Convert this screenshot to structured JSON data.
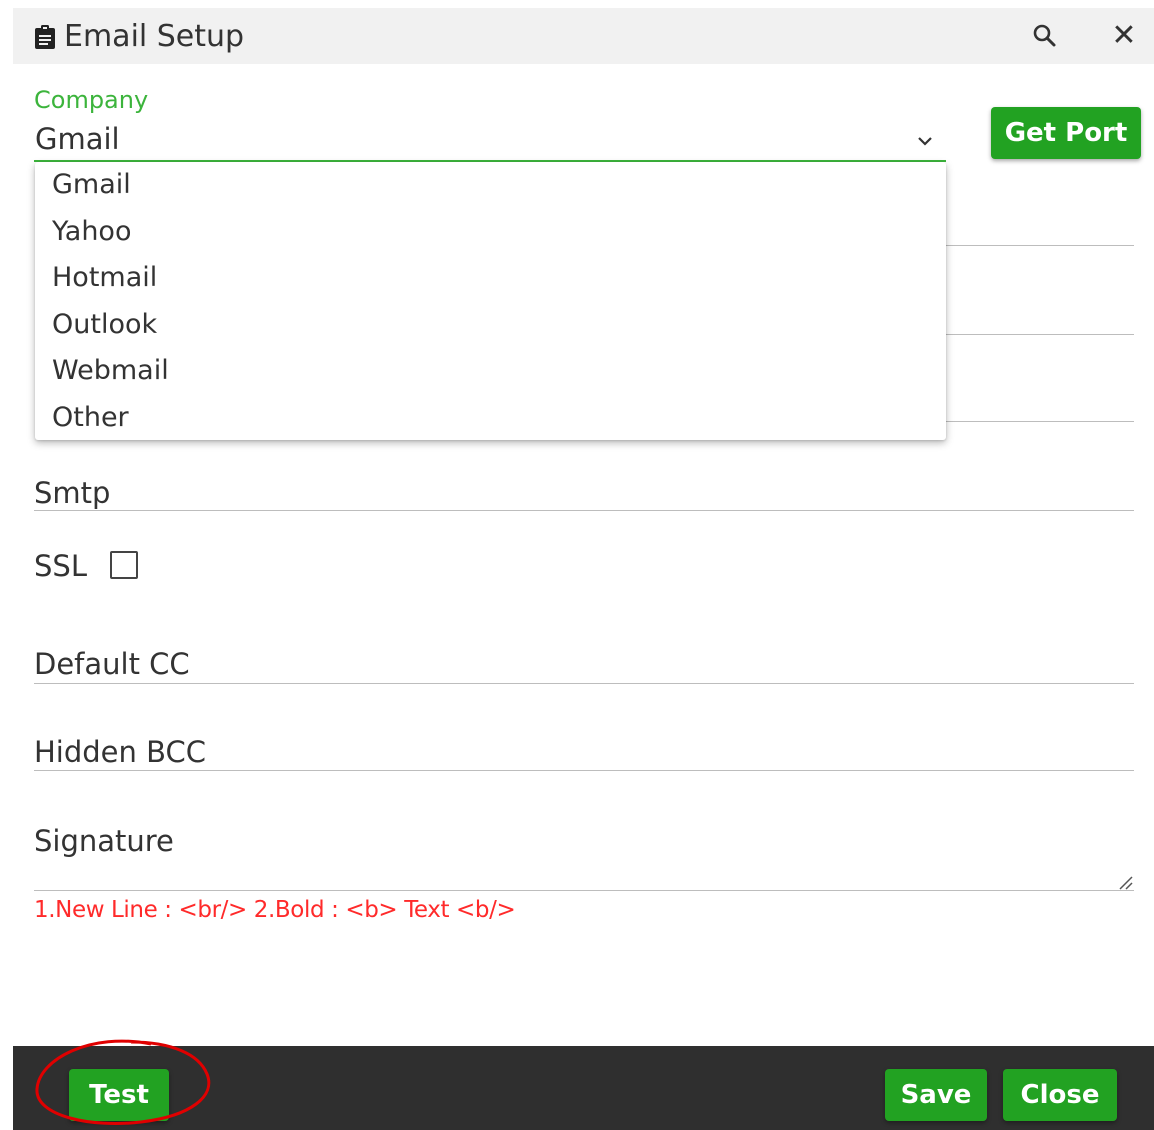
{
  "dialog": {
    "title": "Email Setup",
    "title_icon": "clipboard-icon",
    "header_icons": [
      "search-icon",
      "close-icon"
    ],
    "close_glyph": "✕"
  },
  "company": {
    "label": "Company",
    "value": "Gmail",
    "options": [
      "Gmail",
      "Yahoo",
      "Hotmail",
      "Outlook",
      "Webmail",
      "Other"
    ]
  },
  "buttons": {
    "get_port": "Get Port",
    "test": "Test",
    "save": "Save",
    "close": "Close"
  },
  "fields": {
    "smtp": "Smtp",
    "ssl": "SSL",
    "ssl_checked": false,
    "default_cc": "Default CC",
    "hidden_bcc": "Hidden BCC",
    "signature": "Signature",
    "signature_hint": "1.New Line : <br/> 2.Bold : <b> Text <b/>"
  },
  "colors": {
    "accent_green": "#22a222",
    "focus_green": "#3cb43c",
    "hint_red": "#ff2a2a",
    "footer_bg": "#2f2f2f",
    "annotation_red": "#e00000"
  }
}
